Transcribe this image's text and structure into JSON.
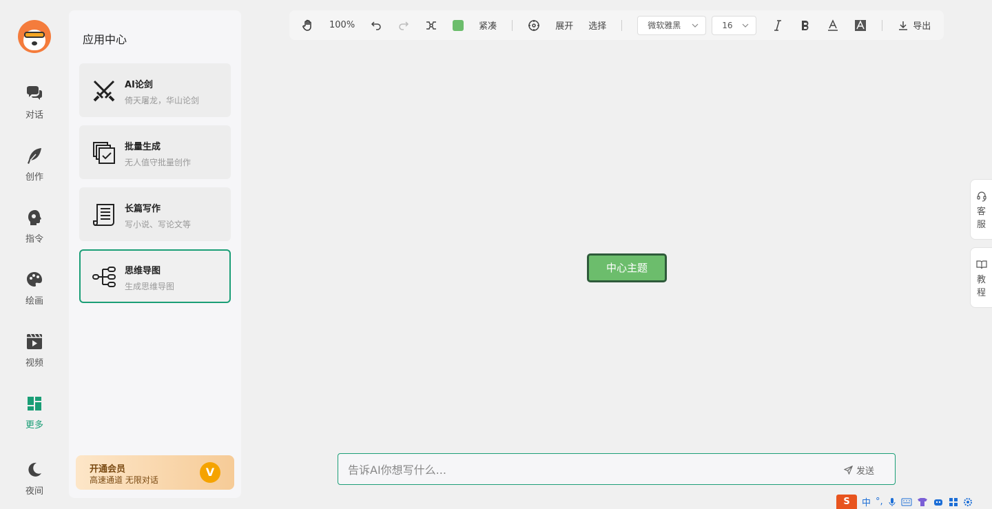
{
  "nav": {
    "items": [
      {
        "label": "对话",
        "icon": "chat-icon"
      },
      {
        "label": "创作",
        "icon": "feather-icon"
      },
      {
        "label": "指令",
        "icon": "head-icon"
      },
      {
        "label": "绘画",
        "icon": "palette-icon"
      },
      {
        "label": "视频",
        "icon": "video-icon"
      },
      {
        "label": "更多",
        "icon": "grid-icon"
      },
      {
        "label": "夜间",
        "icon": "moon-icon"
      }
    ],
    "active_color": "#1a9e76"
  },
  "panel": {
    "title": "应用中心",
    "cards": [
      {
        "title": "AI论剑",
        "sub": "倚天屠龙，华山论剑",
        "icon": "crossed-swords-icon"
      },
      {
        "title": "批量生成",
        "sub": "无人值守批量创作",
        "icon": "batch-check-icon"
      },
      {
        "title": "长篇写作",
        "sub": "写小说、写论文等",
        "icon": "scroll-icon"
      },
      {
        "title": "思维导图",
        "sub": "生成思维导图",
        "icon": "mindmap-icon"
      }
    ],
    "vip": {
      "title": "开通会员",
      "sub": "高速通道 无限对话",
      "badge": "V"
    }
  },
  "toolbar": {
    "zoom": "100%",
    "layout": "紧凑",
    "expand": "展开",
    "select": "选择",
    "font": "微软雅黑",
    "size": "16",
    "export": "导出",
    "node_color": "#6cbd6c"
  },
  "canvas": {
    "root_node": "中心主题"
  },
  "side": {
    "service": [
      "客",
      "服"
    ],
    "tutorial": [
      "教",
      "程"
    ]
  },
  "input": {
    "placeholder": "告诉AI你想写什么...",
    "send": "发送"
  },
  "ime": {
    "logo": "S",
    "mode": "中",
    "punct": "°,"
  }
}
